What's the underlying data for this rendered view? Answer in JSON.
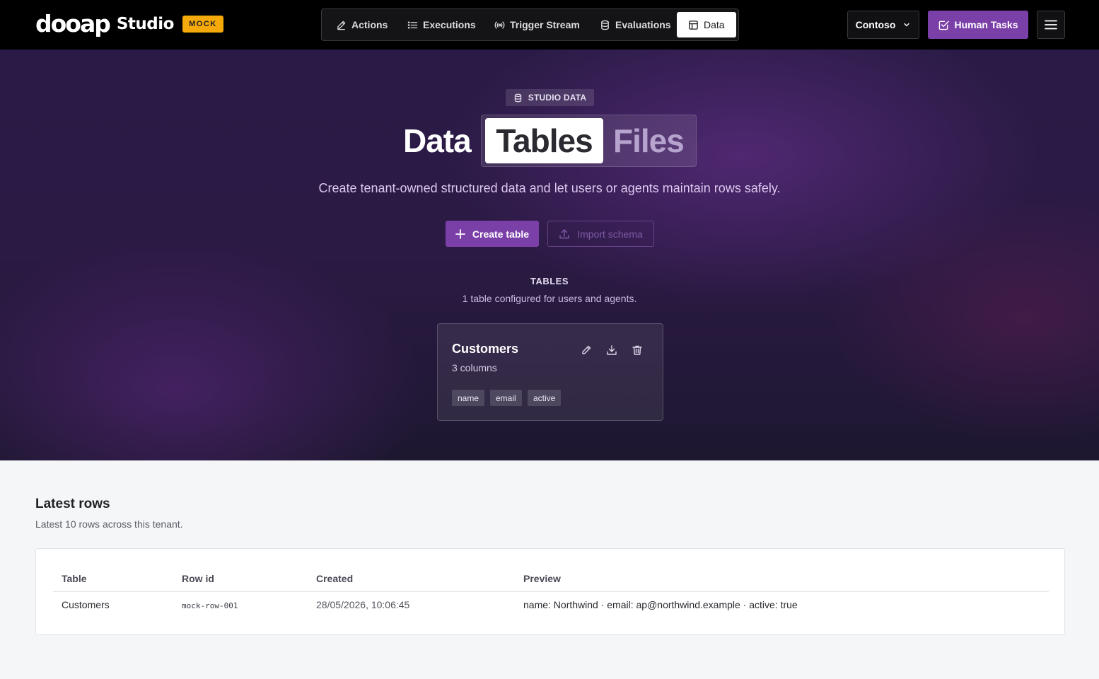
{
  "brand": {
    "logo": "dooap",
    "product": "Studio",
    "badge": "MOCK"
  },
  "nav": {
    "items": [
      {
        "label": "Actions",
        "icon": "pencil-icon"
      },
      {
        "label": "Executions",
        "icon": "list-icon"
      },
      {
        "label": "Trigger Stream",
        "icon": "broadcast-icon"
      },
      {
        "label": "Evaluations",
        "icon": "database-icon"
      },
      {
        "label": "Data",
        "icon": "table-icon",
        "active": true
      }
    ]
  },
  "header": {
    "tenant": "Contoso",
    "human_tasks": "Human Tasks"
  },
  "hero": {
    "eyebrow": "STUDIO DATA",
    "title": "Data",
    "segments": [
      "Tables",
      "Files"
    ],
    "active_segment": "Tables",
    "subtitle": "Create tenant-owned structured data and let users or agents maintain rows safely.",
    "create_button": "Create table",
    "import_button": "Import schema"
  },
  "tables_section": {
    "heading": "TABLES",
    "summary": "1 table configured for users and agents.",
    "tables": [
      {
        "name": "Customers",
        "columns_label": "3 columns",
        "columns": [
          "name",
          "email",
          "active"
        ]
      }
    ]
  },
  "latest_rows": {
    "title": "Latest rows",
    "subtitle": "Latest 10 rows across this tenant.",
    "headers": [
      "Table",
      "Row id",
      "Created",
      "Preview"
    ],
    "rows": [
      {
        "table": "Customers",
        "row_id": "mock-row-001",
        "created": "28/05/2026, 10:06:45",
        "preview": "name: Northwind · email: ap@northwind.example · active: true"
      }
    ]
  },
  "colors": {
    "accent": "#7b3fa8",
    "badge": "#f5a90a",
    "topbar": "#000000"
  }
}
